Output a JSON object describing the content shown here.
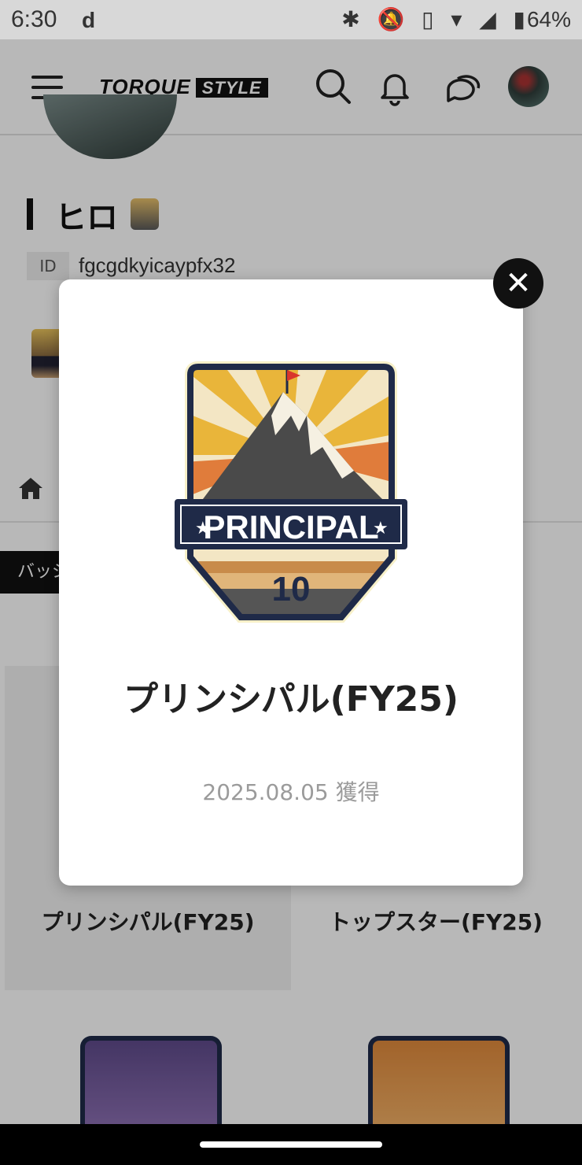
{
  "status_bar": {
    "time": "6:30",
    "app_icon": "d",
    "battery": "64%",
    "icons": [
      "bluetooth-icon",
      "mute-icon",
      "vibrate-off-icon",
      "wifi-icon",
      "signal-icon",
      "battery-icon"
    ]
  },
  "header": {
    "logo_main": "TORQUE",
    "logo_sub": "STYLE",
    "icons": [
      "menu-icon",
      "search-icon",
      "bell-icon",
      "chat-icon",
      "avatar"
    ]
  },
  "profile": {
    "name": "ヒロ",
    "id_label": "ID",
    "id_value": "fgcgdkyicaypfx32"
  },
  "tabs": {
    "badge_tab": "バッジ"
  },
  "badges": [
    {
      "label": "プリンシパル(FY25)"
    },
    {
      "label": "トップスター(FY25)"
    }
  ],
  "modal": {
    "badge_banner": "PRINCIPAL",
    "badge_number": "10",
    "title": "プリンシパル(FY25)",
    "date": "2025.08.05 獲得",
    "close_symbol": "✕"
  },
  "colors": {
    "accent_dark": "#1f2a48",
    "badge_gold": "#e8b23a",
    "flag_red": "#d9352c"
  }
}
